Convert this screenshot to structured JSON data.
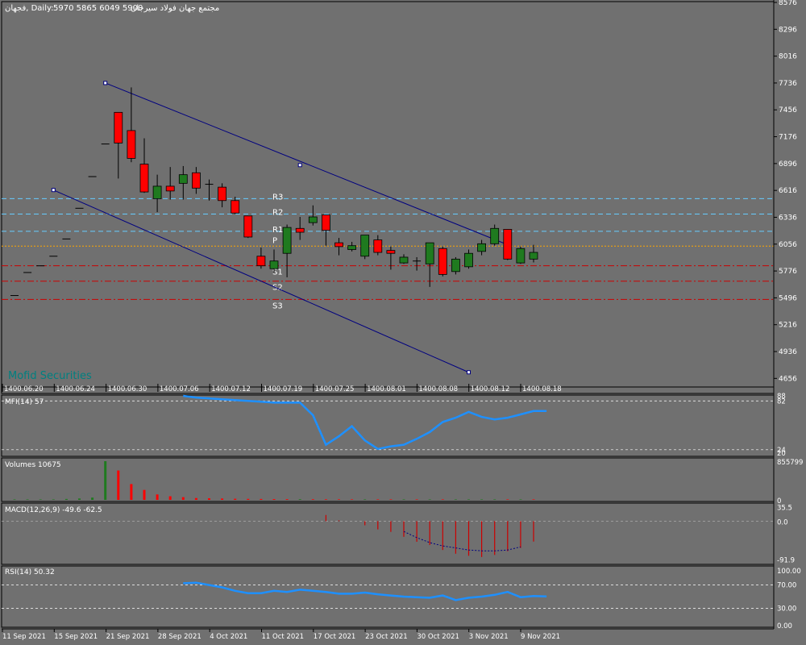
{
  "header": {
    "symbol_label": "فجهان, Daily:",
    "ohlc": "5970 5865 6049 5900",
    "company": "مجتمع جهان فولاد سيرجان"
  },
  "watermark": "Mofid Securities",
  "colors": {
    "background": "#707070",
    "grid": "#000000",
    "bull": "#1f7a1f",
    "bear": "#ff0000",
    "channel": "#000080",
    "pivot_resistance": "#66ccff",
    "pivot_p": "#ffa500",
    "pivot_support": "#cc0000",
    "indicator_line": "#1e90ff",
    "text": "#ffffff"
  },
  "chart_data": [
    {
      "type": "candlestick",
      "name": "price",
      "ylim": [
        4516,
        8576
      ],
      "y_ticks": [
        "8576",
        "8296",
        "8016",
        "7736",
        "7456",
        "7176",
        "6896",
        "6616",
        "6336",
        "6056",
        "5776",
        "5496",
        "5216",
        "4936",
        "4656"
      ],
      "top_dates": [
        "1400.06.20",
        "1400.06.24",
        "1400.06.30",
        "1400.07.06",
        "1400.07.12",
        "1400.07.19",
        "1400.07.25",
        "1400.08.01",
        "1400.08.08",
        "1400.08.12",
        "1400.08.18"
      ],
      "bottom_dates": [
        "11 Sep 2021",
        "15 Sep 2021",
        "21 Sep 2021",
        "28 Sep 2021",
        "4 Oct 2021",
        "11 Oct 2021",
        "17 Oct 2021",
        "23 Oct 2021",
        "30 Oct 2021",
        "3 Nov 2021",
        "9 Nov 2021"
      ],
      "candles": [
        {
          "o": 5520,
          "h": 5520,
          "l": 5520,
          "c": 5520
        },
        {
          "o": 5760,
          "h": 5760,
          "l": 5760,
          "c": 5760
        },
        {
          "o": 5830,
          "h": 5830,
          "l": 5830,
          "c": 5830
        },
        {
          "o": 5930,
          "h": 5930,
          "l": 5930,
          "c": 5930
        },
        {
          "o": 6110,
          "h": 6110,
          "l": 6110,
          "c": 6110
        },
        {
          "o": 6430,
          "h": 6430,
          "l": 6430,
          "c": 6430
        },
        {
          "o": 6760,
          "h": 6760,
          "l": 6760,
          "c": 6760
        },
        {
          "o": 7100,
          "h": 7100,
          "l": 7100,
          "c": 7100
        },
        {
          "o": 7430,
          "h": 7430,
          "l": 6740,
          "c": 7110
        },
        {
          "o": 7240,
          "h": 7690,
          "l": 6910,
          "c": 6950
        },
        {
          "o": 6890,
          "h": 7160,
          "l": 6590,
          "c": 6600
        },
        {
          "o": 6530,
          "h": 6780,
          "l": 6390,
          "c": 6660
        },
        {
          "o": 6660,
          "h": 6860,
          "l": 6520,
          "c": 6610
        },
        {
          "o": 6690,
          "h": 6870,
          "l": 6520,
          "c": 6780
        },
        {
          "o": 6800,
          "h": 6860,
          "l": 6580,
          "c": 6640
        },
        {
          "o": 6680,
          "h": 6730,
          "l": 6510,
          "c": 6680
        },
        {
          "o": 6650,
          "h": 6690,
          "l": 6440,
          "c": 6510
        },
        {
          "o": 6510,
          "h": 6550,
          "l": 6370,
          "c": 6380
        },
        {
          "o": 6350,
          "h": 6350,
          "l": 6120,
          "c": 6130
        },
        {
          "o": 5930,
          "h": 6020,
          "l": 5800,
          "c": 5830
        },
        {
          "o": 5800,
          "h": 6000,
          "l": 5760,
          "c": 5880
        },
        {
          "o": 5960,
          "h": 6260,
          "l": 5710,
          "c": 6230
        },
        {
          "o": 6220,
          "h": 6340,
          "l": 6100,
          "c": 6180
        },
        {
          "o": 6280,
          "h": 6460,
          "l": 6250,
          "c": 6340
        },
        {
          "o": 6360,
          "h": 6360,
          "l": 6040,
          "c": 6200
        },
        {
          "o": 6070,
          "h": 6120,
          "l": 5940,
          "c": 6030
        },
        {
          "o": 6000,
          "h": 6080,
          "l": 5980,
          "c": 6040
        },
        {
          "o": 5930,
          "h": 6150,
          "l": 5900,
          "c": 6150
        },
        {
          "o": 6100,
          "h": 6150,
          "l": 5940,
          "c": 5970
        },
        {
          "o": 5990,
          "h": 6030,
          "l": 5790,
          "c": 5960
        },
        {
          "o": 5860,
          "h": 5950,
          "l": 5850,
          "c": 5920
        },
        {
          "o": 5880,
          "h": 5920,
          "l": 5780,
          "c": 5870
        },
        {
          "o": 5850,
          "h": 6070,
          "l": 5610,
          "c": 6070
        },
        {
          "o": 6010,
          "h": 6030,
          "l": 5720,
          "c": 5740
        },
        {
          "o": 5770,
          "h": 5920,
          "l": 5740,
          "c": 5900
        },
        {
          "o": 5820,
          "h": 6000,
          "l": 5800,
          "c": 5960
        },
        {
          "o": 5980,
          "h": 6100,
          "l": 5940,
          "c": 6060
        },
        {
          "o": 6060,
          "h": 6260,
          "l": 6040,
          "c": 6220
        },
        {
          "o": 6210,
          "h": 6210,
          "l": 5890,
          "c": 5900
        },
        {
          "o": 5860,
          "h": 6030,
          "l": 5850,
          "c": 6010
        },
        {
          "o": 5900,
          "h": 6049,
          "l": 5865,
          "c": 5970
        }
      ],
      "pivots": [
        {
          "label": "R3",
          "value": 6530,
          "color": "#66ccff"
        },
        {
          "label": "R2",
          "value": 6370,
          "color": "#66ccff"
        },
        {
          "label": "R1",
          "value": 6190,
          "color": "#66ccff"
        },
        {
          "label": "P",
          "value": 6035,
          "color": "#ffa500"
        },
        {
          "label": "S1",
          "value": 5830,
          "color": "#cc0000"
        },
        {
          "label": "S2",
          "value": 5670,
          "color": "#cc0000"
        },
        {
          "label": "S3",
          "value": 5480,
          "color": "#cc0000"
        }
      ],
      "channel": {
        "upper": [
          [
            7,
            7736
          ],
          [
            38,
            6050
          ]
        ],
        "lower": [
          [
            3,
            6620
          ],
          [
            35,
            4720
          ]
        ],
        "upper_mid": [
          22,
          6880
        ]
      }
    },
    {
      "type": "line",
      "name": "MFI(14)",
      "label": "MFI(14) 57",
      "ylim": [
        0,
        100
      ],
      "y_ticks": [
        "88",
        "82",
        "24",
        "20"
      ],
      "levels": [
        82,
        24
      ],
      "start_index": 13,
      "values": [
        88,
        86,
        85,
        84,
        83,
        82,
        81,
        80,
        80,
        80,
        65,
        30,
        40,
        52,
        35,
        25,
        28,
        30,
        37,
        45,
        57,
        62,
        69,
        63,
        60,
        62,
        66,
        70,
        70
      ]
    },
    {
      "type": "bar",
      "name": "Volumes",
      "label": "Volumes 10675",
      "ylim": [
        0,
        855799
      ],
      "y_ticks": [
        "855799",
        "0"
      ],
      "values": [
        10675,
        10675,
        10675,
        10675,
        20000,
        30000,
        50000,
        855799,
        650000,
        350000,
        220000,
        120000,
        80000,
        60000,
        40000,
        35000,
        30000,
        25000,
        22000,
        20000,
        18000,
        16000,
        15000,
        14000,
        13000,
        12000,
        11000,
        11000,
        10800,
        10700,
        10675,
        10675,
        10675,
        10675,
        10675,
        10675,
        10675,
        10675,
        10675,
        10675,
        10675
      ],
      "up": [
        true,
        true,
        true,
        true,
        true,
        true,
        true,
        true,
        false,
        false,
        false,
        false,
        false,
        false,
        false,
        false,
        false,
        false,
        false,
        false,
        false,
        false,
        true,
        false,
        false,
        false,
        false,
        true,
        false,
        false,
        true,
        false,
        true,
        false,
        true,
        true,
        true,
        true,
        false,
        true,
        false
      ]
    },
    {
      "type": "histogram",
      "name": "MACD(12,26,9)",
      "label": "MACD(12,26,9) -49.6 -62.5",
      "ylim": [
        -101,
        38
      ],
      "y_ticks": [
        "35.5",
        "0.0",
        "-91.9"
      ],
      "start_index": 24,
      "histogram": [
        15,
        2,
        0,
        -10,
        -20,
        -26,
        -38,
        -50,
        -58,
        -70,
        -79,
        -84,
        -87,
        -82,
        -73,
        -65,
        -49.6
      ],
      "signal_start": 30,
      "signal": [
        -25,
        -40,
        -52,
        -60,
        -65,
        -70,
        -72,
        -72,
        -70,
        -62.5
      ]
    },
    {
      "type": "line",
      "name": "RSI(14)",
      "label": "RSI(14) 50.32",
      "ylim": [
        0,
        100
      ],
      "y_ticks": [
        "100.00",
        "70.00",
        "30.00",
        "0.00"
      ],
      "levels": [
        70,
        30
      ],
      "start_index": 13,
      "values": [
        73,
        74,
        70,
        66,
        60,
        56,
        56,
        60,
        58,
        62,
        60,
        58,
        55,
        55,
        57,
        54,
        52,
        50,
        49,
        48,
        52,
        44,
        48,
        50,
        53,
        58,
        49,
        51,
        50.32
      ]
    }
  ]
}
